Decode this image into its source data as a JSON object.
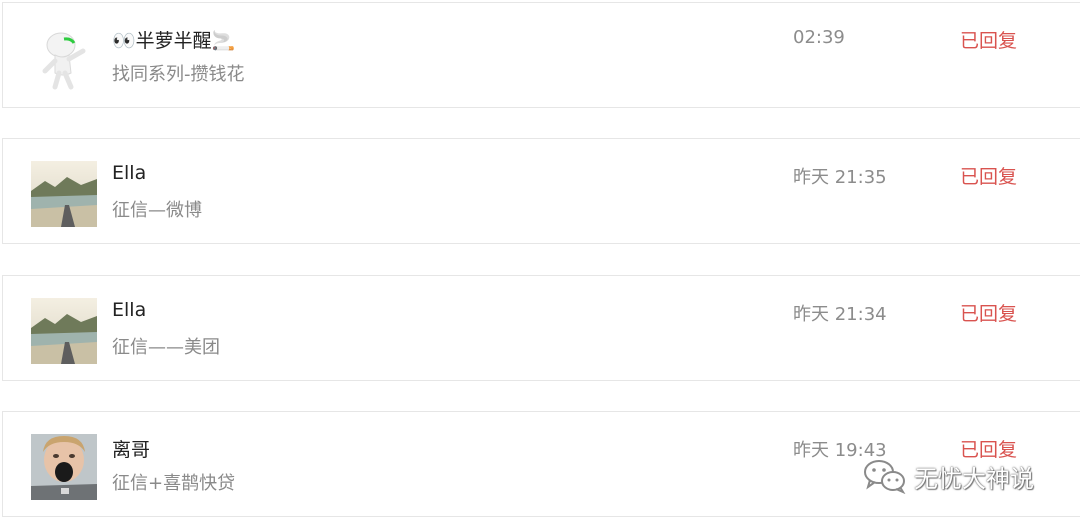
{
  "messages": [
    {
      "name": "👀半萝半醒🚬",
      "subtitle": "找同系列-攒钱花",
      "time": "02:39",
      "status": "已回复",
      "avatar_icon": "white-figure-avatar"
    },
    {
      "name": "Ella",
      "subtitle": "征信—微博",
      "time": "昨天 21:35",
      "status": "已回复",
      "avatar_icon": "mountain-landscape-avatar"
    },
    {
      "name": "Ella",
      "subtitle": "征信——美团",
      "time": "昨天 21:34",
      "status": "已回复",
      "avatar_icon": "mountain-landscape-avatar"
    },
    {
      "name": "离哥",
      "subtitle": "征信+喜鹊快贷",
      "time": "昨天 19:43",
      "status": "已回复",
      "avatar_icon": "person-face-avatar"
    }
  ],
  "watermark": {
    "text": "无忧大神说",
    "icon": "wechat-icon"
  },
  "colors": {
    "status": "#d9534f",
    "time": "#8c8c8c",
    "subtitle": "#8a8a8a",
    "border": "#e6e6e6"
  }
}
